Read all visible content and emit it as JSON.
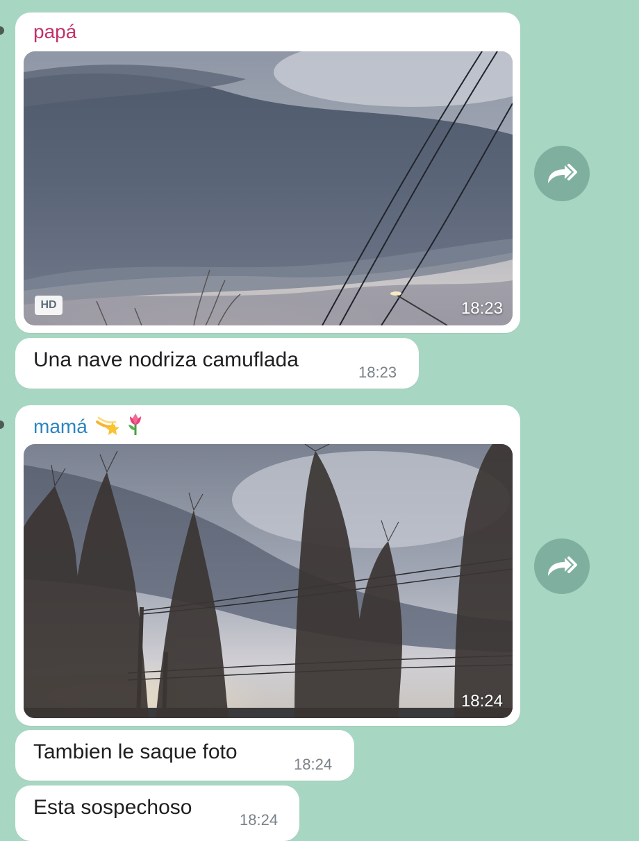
{
  "messages": {
    "papa": {
      "sender": "papá",
      "sender_color": "#c2306b",
      "photo_badge": "HD",
      "photo_time": "18:23",
      "caption": {
        "text": "Una nave nodriza camuflada",
        "time": "18:23"
      }
    },
    "mama": {
      "sender": "mamá",
      "sender_emoji": [
        "shooting-star-icon",
        "tulip-icon"
      ],
      "sender_color": "#2b84bf",
      "photo_time": "18:24",
      "captions": [
        {
          "text": "Tambien le saque foto",
          "time": "18:24"
        },
        {
          "text": "Esta sospechoso",
          "time": "18:24"
        }
      ]
    }
  },
  "forward_icon": "share-forward-icon",
  "colors": {
    "background": "#a7d6c2",
    "bubble": "#ffffff",
    "forward_button": "#7fb09f"
  }
}
